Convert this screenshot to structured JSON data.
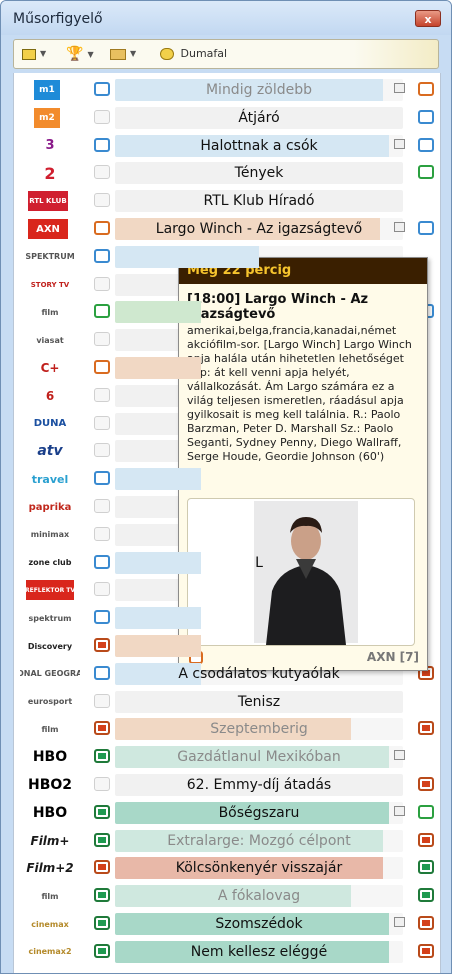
{
  "window": {
    "title": "Műsorfigyelő",
    "close_label": "x"
  },
  "toolbar": {
    "talk_label": "Dumafal"
  },
  "channels": [
    {
      "logo": "m1",
      "program": "Mindig zöldebb",
      "progress": 0.93,
      "bar": "#d5e7f3",
      "text": "#8a8a8a",
      "icon1": "blue",
      "icon2": "orange",
      "sq": true
    },
    {
      "logo": "m2",
      "program": "Átjáró",
      "progress": 0,
      "bar": "#f1f1f1",
      "text": "#111",
      "icon1": "none",
      "icon2": "blue",
      "sq": false
    },
    {
      "logo": "3",
      "program": "Halottnak a csók",
      "progress": 0.95,
      "bar": "#d5e7f3",
      "text": "#111",
      "icon1": "blue",
      "icon2": "blue",
      "sq": true
    },
    {
      "logo": "2",
      "program": "Tények",
      "progress": 0,
      "bar": "#f1f1f1",
      "text": "#111",
      "icon1": "none",
      "icon2": "green",
      "sq": false
    },
    {
      "logo": "RTL KLUB",
      "program": "RTL Klub Híradó",
      "progress": 0,
      "bar": "#f1f1f1",
      "text": "#111",
      "icon1": "none",
      "icon2": "none",
      "sq": false
    },
    {
      "logo": "AXN",
      "program": "Largo Winch - Az igazságtevő",
      "progress": 0.92,
      "bar": "#f1d8c4",
      "text": "#111",
      "icon1": "orange",
      "icon2": "blue",
      "sq": true
    },
    {
      "logo": "SPEKTRUM",
      "program": "",
      "progress": 0.5,
      "bar": "#d5e7f3",
      "text": "#111",
      "icon1": "blue",
      "icon2": "none",
      "sq": false
    },
    {
      "logo": "STORY TV",
      "program": "",
      "progress": 0,
      "bar": "#f1f1f1",
      "text": "#111",
      "icon1": "none",
      "icon2": "none",
      "sq": false
    },
    {
      "logo": "film",
      "program": "",
      "progress": 0.3,
      "bar": "#cfe8cf",
      "text": "#111",
      "icon1": "green",
      "icon2": "blue",
      "sq": false
    },
    {
      "logo": "viasat",
      "program": "",
      "progress": 0,
      "bar": "#f1f1f1",
      "text": "#111",
      "icon1": "none",
      "icon2": "none",
      "sq": false
    },
    {
      "logo": "C+",
      "program": "",
      "progress": 0.3,
      "bar": "#f1d8c4",
      "text": "#111",
      "icon1": "orange",
      "icon2": "none",
      "sq": false
    },
    {
      "logo": "6",
      "program": "",
      "progress": 0,
      "bar": "#f1f1f1",
      "text": "#111",
      "icon1": "none",
      "icon2": "none",
      "sq": false
    },
    {
      "logo": "DUNA",
      "program": "",
      "progress": 0,
      "bar": "#f1f1f1",
      "text": "#111",
      "icon1": "none",
      "icon2": "none",
      "sq": false
    },
    {
      "logo": "atv",
      "program": "",
      "progress": 0,
      "bar": "#f1f1f1",
      "text": "#111",
      "icon1": "none",
      "icon2": "none",
      "sq": false
    },
    {
      "logo": "travel",
      "program": "",
      "progress": 0.3,
      "bar": "#d5e7f3",
      "text": "#111",
      "icon1": "blue",
      "icon2": "none",
      "sq": false
    },
    {
      "logo": "paprika",
      "program": "",
      "progress": 0,
      "bar": "#f1f1f1",
      "text": "#111",
      "icon1": "none",
      "icon2": "none",
      "sq": false
    },
    {
      "logo": "minimax",
      "program": "",
      "progress": 0,
      "bar": "#f1f1f1",
      "text": "#111",
      "icon1": "none",
      "icon2": "none",
      "sq": false
    },
    {
      "logo": "zone club",
      "program": "L",
      "progress": 0.3,
      "bar": "#d5e7f3",
      "text": "#111",
      "icon1": "blue",
      "icon2": "none",
      "sq": false
    },
    {
      "logo": "REFLEKTOR TV",
      "program": "",
      "progress": 0,
      "bar": "#f1f1f1",
      "text": "#111",
      "icon1": "none",
      "icon2": "none",
      "sq": false
    },
    {
      "logo": "spektrum",
      "program": "",
      "progress": 0.3,
      "bar": "#d5e7f3",
      "text": "#111",
      "icon1": "blue",
      "icon2": "none",
      "sq": false
    },
    {
      "logo": "Discovery",
      "program": "",
      "progress": 0.3,
      "bar": "#f1d8c4",
      "text": "#111",
      "icon1": "orangefill",
      "icon2": "none",
      "sq": false
    },
    {
      "logo": "NATIONAL GEOGRAPHIC",
      "program": "A csodálatos kutyaólak",
      "progress": 0.3,
      "bar": "#d5e7f3",
      "text": "#111",
      "icon1": "blue",
      "icon2": "orangefill",
      "sq": false
    },
    {
      "logo": "eurosport",
      "program": "Tenisz",
      "progress": 0,
      "bar": "#f1f1f1",
      "text": "#111",
      "icon1": "none",
      "icon2": "none",
      "sq": false
    },
    {
      "logo": "film",
      "program": "Szeptemberig",
      "progress": 0.82,
      "bar": "#f1d8c4",
      "text": "#8a8a8a",
      "icon1": "orangefill",
      "icon2": "orangefill",
      "sq": false
    },
    {
      "logo": "HBO",
      "program": "Gazdátlanul Mexikóban",
      "progress": 0.95,
      "bar": "#cfe8df",
      "text": "#8a8a8a",
      "icon1": "greenfill",
      "icon2": "none",
      "sq": true
    },
    {
      "logo": "HBO2",
      "program": "62. Emmy-díj átadás",
      "progress": 0,
      "bar": "#f1f1f1",
      "text": "#111",
      "icon1": "none",
      "icon2": "orangefill",
      "sq": false
    },
    {
      "logo": "HBO",
      "program": "Bőségszaru",
      "progress": 0.95,
      "bar": "#a8d8c8",
      "text": "#111",
      "icon1": "greenfill",
      "icon2": "green",
      "sq": true
    },
    {
      "logo": "Film+",
      "program": "Extralarge: Mozgó célpont",
      "progress": 0.93,
      "bar": "#cfe8df",
      "text": "#8a8a8a",
      "icon1": "greenfill",
      "icon2": "orangefill",
      "sq": false
    },
    {
      "logo": "Film+2",
      "program": "Kölcsönkenyér visszajár",
      "progress": 0.93,
      "bar": "#e8b8a8",
      "text": "#111",
      "icon1": "orangefill",
      "icon2": "greenfill",
      "sq": false
    },
    {
      "logo": "film",
      "program": "A fókalovag",
      "progress": 0.82,
      "bar": "#cfe8df",
      "text": "#8a8a8a",
      "icon1": "greenfill",
      "icon2": "greenfill",
      "sq": false
    },
    {
      "logo": "cinemax",
      "program": "Szomszédok",
      "progress": 0.95,
      "bar": "#a8d8c8",
      "text": "#111",
      "icon1": "greenfill",
      "icon2": "orangefill",
      "sq": true
    },
    {
      "logo": "cinemax2",
      "program": "Nem kellesz eléggé",
      "progress": 0.95,
      "bar": "#a8d8c8",
      "text": "#111",
      "icon1": "greenfill",
      "icon2": "orangefill",
      "sq": false
    }
  ],
  "popup": {
    "header": "Még 22 percig",
    "title": "[18:00] Largo Winch - Az igazságtevő",
    "description": "amerikai,belga,francia,kanadai,német akciófilm-sor. [Largo Winch] Largo Winch apja halála után hihetetlen lehetőséget kap: át kell venni apja helyét, vállalkozását. Ám Largo számára ez a világ teljesen ismeretlen, ráadásul apja gyilkosait is meg kell találnia. R.: Paolo Barzman, Peter D. Marshall Sz.: Paolo Seganti, Sydney Penny, Diego Wallraff, Serge Houde, Geordie Johnson (60')",
    "channel": "AXN [7]"
  },
  "colors": {
    "accent": "#f6c42d",
    "popup_head": "#3a1f00"
  }
}
